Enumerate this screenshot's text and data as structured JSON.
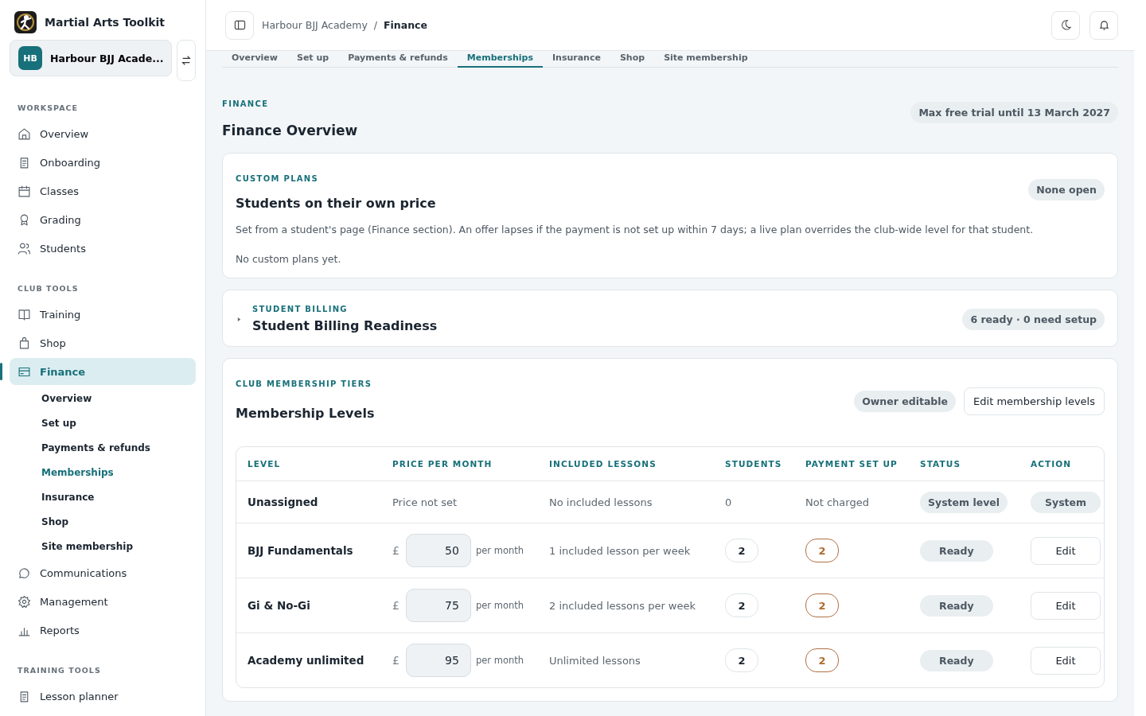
{
  "app": {
    "name": "Martial Arts Toolkit"
  },
  "club_switcher": {
    "initials": "HB",
    "name": "Harbour BJJ Acade..."
  },
  "sidebar": {
    "sections": [
      {
        "heading": "WORKSPACE",
        "items": [
          {
            "label": "Overview",
            "selected": false
          },
          {
            "label": "Onboarding",
            "selected": false
          },
          {
            "label": "Classes",
            "selected": false
          },
          {
            "label": "Grading",
            "selected": false
          },
          {
            "label": "Students",
            "selected": false
          }
        ]
      },
      {
        "heading": "CLUB TOOLS",
        "items": [
          {
            "label": "Training",
            "selected": false
          },
          {
            "label": "Shop",
            "selected": false
          },
          {
            "label": "Finance",
            "selected": true,
            "children": [
              {
                "label": "Overview",
                "selected": false
              },
              {
                "label": "Set up",
                "selected": false
              },
              {
                "label": "Payments & refunds",
                "selected": false
              },
              {
                "label": "Memberships",
                "selected": true
              },
              {
                "label": "Insurance",
                "selected": false
              },
              {
                "label": "Shop",
                "selected": false
              },
              {
                "label": "Site membership",
                "selected": false
              }
            ]
          },
          {
            "label": "Communications",
            "selected": false
          },
          {
            "label": "Management",
            "selected": false
          },
          {
            "label": "Reports",
            "selected": false
          }
        ]
      },
      {
        "heading": "TRAINING TOOLS",
        "items": [
          {
            "label": "Lesson planner",
            "selected": false
          }
        ]
      }
    ]
  },
  "breadcrumb": {
    "parent": "Harbour BJJ Academy",
    "separator": "/",
    "current": "Finance"
  },
  "tabs": [
    {
      "label": "Overview",
      "selected": false
    },
    {
      "label": "Set up",
      "selected": false
    },
    {
      "label": "Payments & refunds",
      "selected": false
    },
    {
      "label": "Memberships",
      "selected": true
    },
    {
      "label": "Insurance",
      "selected": false
    },
    {
      "label": "Shop",
      "selected": false
    },
    {
      "label": "Site membership",
      "selected": false
    }
  ],
  "page": {
    "eyebrow": "FINANCE",
    "title": "Finance Overview",
    "trial_badge": "Max free trial until 13 March 2027"
  },
  "custom_plans": {
    "eyebrow": "CUSTOM PLANS",
    "title": "Students on their own price",
    "badge": "None open",
    "description": "Set from a student's page (Finance section). An offer lapses if the payment is not set up within 7 days; a live plan overrides the club-wide level for that student.",
    "empty": "No custom plans yet."
  },
  "billing": {
    "eyebrow": "STUDENT BILLING",
    "title": "Student Billing Readiness",
    "badge": "6 ready · 0 need setup",
    "expanded": false
  },
  "membership": {
    "eyebrow": "CLUB MEMBERSHIP TIERS",
    "title": "Membership Levels",
    "badge": "Owner editable",
    "button": "Edit membership levels",
    "table": {
      "columns": [
        "LEVEL",
        "PRICE PER MONTH",
        "INCLUDED LESSONS",
        "STUDENTS",
        "PAYMENT SET UP",
        "STATUS",
        "ACTION"
      ],
      "rows": [
        {
          "kind": "system",
          "level": "Unassigned",
          "price": "Price not set",
          "lessons": "No included lessons",
          "students": "0",
          "payment": "Not charged",
          "status": "System level",
          "action": "System"
        },
        {
          "kind": "priced",
          "level": "BJJ Fundamentals",
          "currency": "£",
          "price": "50",
          "unit": "per month",
          "lessons": "1 included lesson per week",
          "students": "2",
          "payment": "2",
          "status": "Ready",
          "action": "Edit"
        },
        {
          "kind": "priced",
          "level": "Gi & No-Gi",
          "currency": "£",
          "price": "75",
          "unit": "per month",
          "lessons": "2 included lessons per week",
          "students": "2",
          "payment": "2",
          "status": "Ready",
          "action": "Edit"
        },
        {
          "kind": "priced",
          "level": "Academy unlimited",
          "currency": "£",
          "price": "95",
          "unit": "per month",
          "lessons": "Unlimited lessons",
          "students": "2",
          "payment": "2",
          "status": "Ready",
          "action": "Edit"
        }
      ]
    }
  }
}
